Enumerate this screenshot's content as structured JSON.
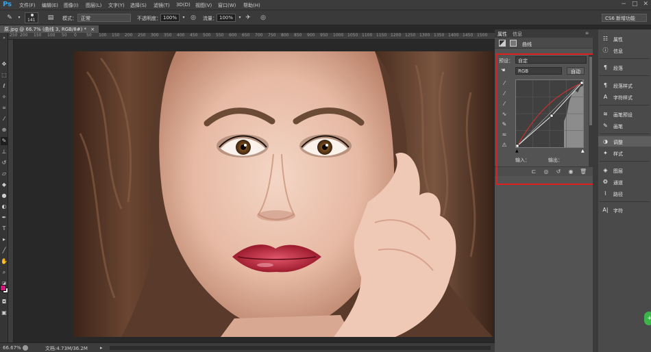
{
  "app": {
    "logo": "Ps",
    "menu": [
      "文件(F)",
      "编辑(E)",
      "图像(I)",
      "图层(L)",
      "文字(Y)",
      "选择(S)",
      "滤镜(T)",
      "3D(D)",
      "视图(V)",
      "窗口(W)",
      "帮助(H)"
    ],
    "window_controls": [
      "−",
      "□",
      "✕"
    ]
  },
  "options": {
    "brush_size": "141",
    "mode_label": "模式：",
    "mode_value": "正常",
    "opacity_label": "不透明度：",
    "opacity_value": "100%",
    "flow_label": "流量：",
    "flow_value": "100%",
    "workspace": "CS6 新增功能"
  },
  "document": {
    "tab_title": "原.jpg @ 66.7% (曲线 3, RGB/8#) *",
    "tab_close": "×"
  },
  "ruler": {
    "ticks": [
      "250",
      "200",
      "150",
      "100",
      "50",
      "0",
      "50",
      "100",
      "150",
      "200",
      "250",
      "300",
      "350",
      "400",
      "450",
      "500",
      "550",
      "600",
      "650",
      "700",
      "750",
      "800",
      "850",
      "900",
      "950",
      "1000",
      "1050",
      "1100",
      "1150",
      "1200",
      "1250",
      "1300",
      "1350",
      "1400",
      "1450",
      "1500"
    ]
  },
  "status": {
    "zoom": "66.67%",
    "doc_info": "文档:4.73M/36.2M"
  },
  "properties": {
    "tabs": [
      "属性",
      "信息"
    ],
    "panel_title": "曲线",
    "preset_label": "预设：",
    "preset_value": "自定",
    "channel_value": "RGB",
    "auto_button": "自动",
    "input_label": "输入：",
    "output_label": "输出："
  },
  "dock": {
    "items": [
      {
        "icon": "properties-icon",
        "label": "属性"
      },
      {
        "icon": "info-icon",
        "label": "信息"
      },
      {
        "icon": "paragraph-icon",
        "label": "段落"
      },
      {
        "icon": "paragraph-style-icon",
        "label": "段落样式"
      },
      {
        "icon": "character-style-icon",
        "label": "字符样式"
      },
      {
        "icon": "brush-preset-icon",
        "label": "画笔预设"
      },
      {
        "icon": "brush-icon",
        "label": "画笔"
      },
      {
        "icon": "adjustments-icon",
        "label": "调整"
      },
      {
        "icon": "styles-icon",
        "label": "样式"
      },
      {
        "icon": "layers-icon",
        "label": "图层"
      },
      {
        "icon": "channels-icon",
        "label": "通道"
      },
      {
        "icon": "paths-icon",
        "label": "路径"
      },
      {
        "icon": "character-icon",
        "label": "字符"
      }
    ]
  },
  "colors": {
    "foreground": "#d4177a",
    "background": "#ffffff",
    "highlight": "#e0201f",
    "ps_blue": "#2fa3ea"
  }
}
